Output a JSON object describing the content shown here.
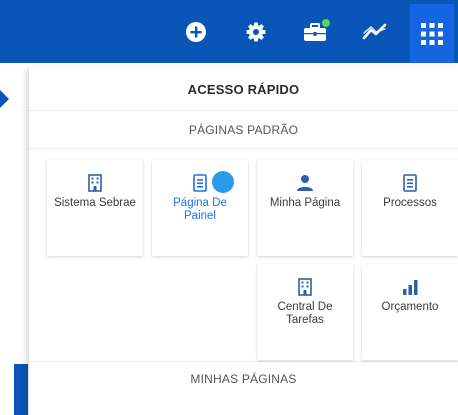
{
  "toolbar": {
    "buttons": [
      {
        "icon": "add-circle-icon"
      },
      {
        "icon": "gear-icon"
      },
      {
        "icon": "briefcase-icon"
      },
      {
        "icon": "trend-chart-icon"
      },
      {
        "icon": "apps-grid-icon"
      }
    ],
    "active_color": "#1565e0",
    "bar_color": "#0a56b8",
    "notification_color": "#5cd65c"
  },
  "panel": {
    "title": "ACESSO RÁPIDO",
    "default_pages_heading": "PÁGINAS PADRÃO",
    "my_pages_heading": "MINHAS PÁGINAS",
    "tiles": [
      {
        "label": "Sistema Sebrae",
        "icon": "building-icon"
      },
      {
        "label": "Página De Painel",
        "icon": "document-icon"
      },
      {
        "label": "Minha Página",
        "icon": "person-icon"
      },
      {
        "label": "Processos",
        "icon": "document-icon"
      },
      {
        "label": "Central De Tarefas",
        "icon": "building-icon"
      },
      {
        "label": "Orçamento",
        "icon": "bar-chart-icon"
      }
    ],
    "accent_color": "#1a73e8"
  }
}
